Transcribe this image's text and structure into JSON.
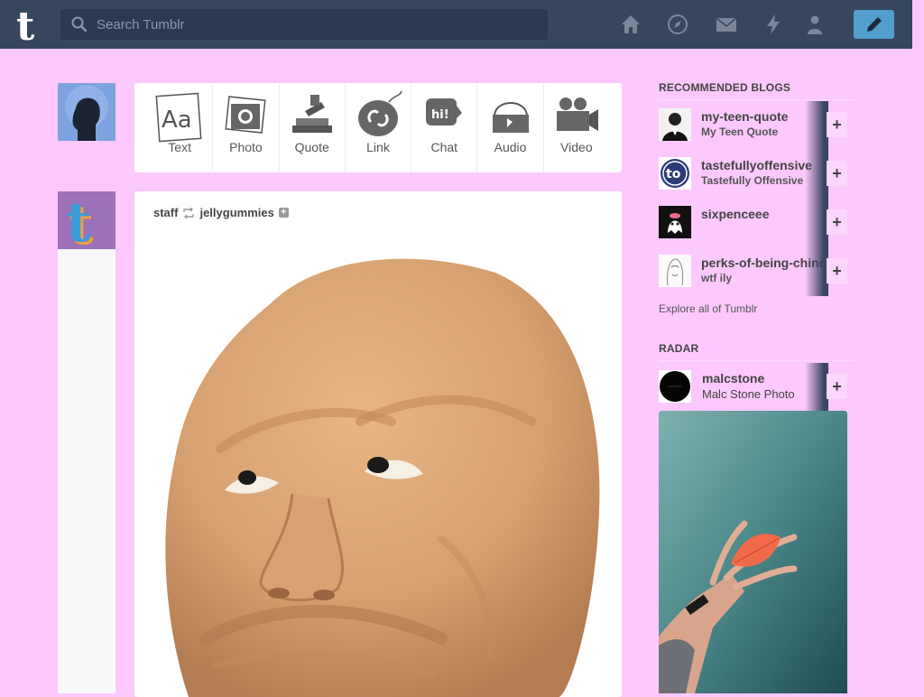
{
  "header": {
    "search_placeholder": "Search Tumblr",
    "nav_icons": [
      "home-icon",
      "explore-icon",
      "inbox-icon",
      "activity-icon",
      "account-icon"
    ],
    "compose_icon": "pencil-icon",
    "colors": {
      "bar": "#36465d",
      "compose": "#529ecc"
    }
  },
  "post_types": [
    {
      "label": "Text",
      "icon": "text-icon"
    },
    {
      "label": "Photo",
      "icon": "photo-icon"
    },
    {
      "label": "Quote",
      "icon": "quote-icon"
    },
    {
      "label": "Link",
      "icon": "link-icon"
    },
    {
      "label": "Chat",
      "icon": "chat-icon"
    },
    {
      "label": "Audio",
      "icon": "audio-icon"
    },
    {
      "label": "Video",
      "icon": "video-icon"
    }
  ],
  "post": {
    "author": "staff",
    "reblogged_from": "jellygummies"
  },
  "sidebar": {
    "recommended_title": "RECOMMENDED BLOGS",
    "recommended": [
      {
        "name": "my-teen-quote",
        "title": "My Teen Quote"
      },
      {
        "name": "tastefullyoffensive",
        "title": "Tastefully Offensive"
      },
      {
        "name": "sixpenceee",
        "title": ""
      },
      {
        "name": "perks-of-being-chinese",
        "title": "wtf ily"
      }
    ],
    "follow_label": "+",
    "explore_link": "Explore all of Tumblr",
    "radar_title": "RADAR",
    "radar_blog": {
      "name": "malcstone",
      "title": "Malc Stone Photo"
    }
  },
  "page_background": "#fdc8fe"
}
